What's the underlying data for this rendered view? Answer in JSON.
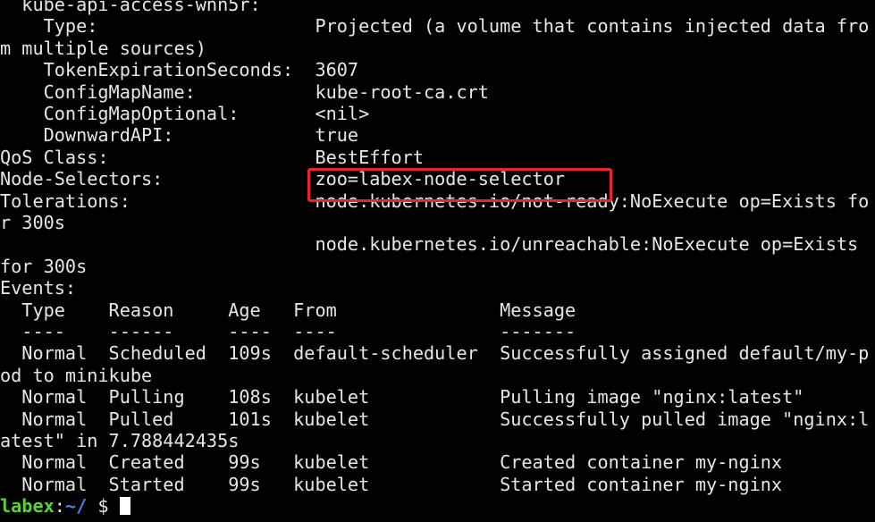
{
  "colors": {
    "background": "#000000",
    "foreground": "#e6e6e6",
    "prompt_user": "#5bd13a",
    "prompt_path": "#4d7cff",
    "highlight_box": "#e8262a",
    "cursor": "#ffffff"
  },
  "terminal": {
    "lines": [
      "  kube-api-access-wnn5r:",
      "    Type:                    Projected (a volume that contains injected data fro",
      "m multiple sources)",
      "    TokenExpirationSeconds:  3607",
      "    ConfigMapName:           kube-root-ca.crt",
      "    ConfigMapOptional:       <nil>",
      "    DownwardAPI:             true",
      "QoS Class:                   BestEffort",
      "Node-Selectors:              zoo=labex-node-selector",
      "Tolerations:                 node.kubernetes.io/not-ready:NoExecute op=Exists fo",
      "r 300s",
      "                             node.kubernetes.io/unreachable:NoExecute op=Exists",
      "for 300s",
      "Events:",
      "  Type    Reason     Age   From               Message",
      "  ----    ------     ----  ----               -------",
      "  Normal  Scheduled  109s  default-scheduler  Successfully assigned default/my-p",
      "od to minikube",
      "  Normal  Pulling    108s  kubelet            Pulling image \"nginx:latest\"",
      "  Normal  Pulled     101s  kubelet            Successfully pulled image \"nginx:l",
      "atest\" in 7.788442435s",
      "  Normal  Created    99s   kubelet            Created container my-nginx",
      "  Normal  Started    99s   kubelet            Started container my-nginx"
    ],
    "prompt": {
      "user": "labex",
      "separator": ":",
      "path": "~/",
      "symbol": " $ "
    }
  }
}
